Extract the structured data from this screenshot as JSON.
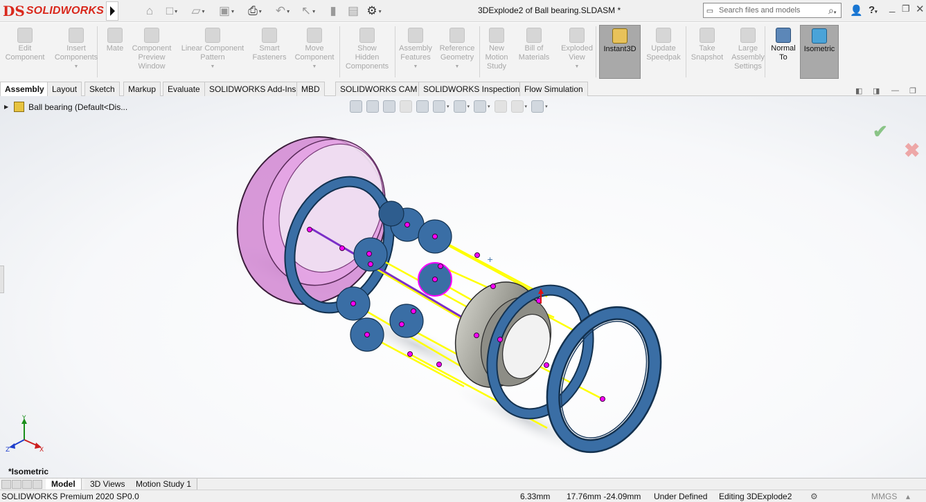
{
  "titlebar": {
    "app_logo": "SOLIDWORKS",
    "logo_mark": "DS",
    "document_title": "3DExplode2 of Ball bearing.SLDASM *",
    "search_placeholder": "Search files and models",
    "quick_access_icons": [
      "home-icon",
      "new-document-icon",
      "open-folder-icon",
      "save-icon",
      "print-icon",
      "undo-icon",
      "select-cursor-icon",
      "rebuild-icon",
      "file-properties-icon",
      "options-gear-icon"
    ],
    "right_icons": [
      "user-icon",
      "help-icon",
      "minimize-icon",
      "restore-icon",
      "close-icon"
    ],
    "help_glyph": "?"
  },
  "commands": [
    {
      "label": "Edit\nComponent",
      "enabled": false
    },
    {
      "label": "Insert\nComponents",
      "enabled": false,
      "dropdown": true
    },
    {
      "label": "Mate",
      "enabled": false
    },
    {
      "label": "Component\nPreview\nWindow",
      "enabled": false
    },
    {
      "label": "Linear Component\nPattern",
      "enabled": false,
      "dropdown": true
    },
    {
      "label": "Smart\nFasteners",
      "enabled": false
    },
    {
      "label": "Move\nComponent",
      "enabled": false,
      "dropdown": true
    },
    {
      "label": "Show\nHidden\nComponents",
      "enabled": false
    },
    {
      "label": "Assembly\nFeatures",
      "enabled": false,
      "dropdown": true
    },
    {
      "label": "Reference\nGeometry",
      "enabled": false,
      "dropdown": true
    },
    {
      "label": "New\nMotion\nStudy",
      "enabled": false
    },
    {
      "label": "Bill of\nMaterials",
      "enabled": false
    },
    {
      "label": "Exploded\nView",
      "enabled": false,
      "dropdown": true
    },
    {
      "label": "Instant3D",
      "enabled": true,
      "pressed": true
    },
    {
      "label": "Update\nSpeedpak",
      "enabled": false
    },
    {
      "label": "Take\nSnapshot",
      "enabled": false
    },
    {
      "label": "Large\nAssembly\nSettings",
      "enabled": false
    },
    {
      "label": "Normal\nTo",
      "enabled": true
    },
    {
      "label": "Isometric",
      "enabled": true,
      "pressed": true
    }
  ],
  "tabs": [
    "Assembly",
    "Layout",
    "Sketch",
    "Markup",
    "Evaluate",
    "SOLIDWORKS Add-Ins",
    "MBD",
    "SOLIDWORKS CAM",
    "SOLIDWORKS Inspection",
    "Flow Simulation"
  ],
  "active_tab": "Assembly",
  "feature_tree": {
    "root_label": "Ball bearing  (Default<Dis..."
  },
  "viewport": {
    "view_name": "*Isometric",
    "triad_labels": {
      "x": "X",
      "y": "Y",
      "z": "Z"
    }
  },
  "bottom_tabs": [
    "Model",
    "3D Views",
    "Motion Study 1"
  ],
  "active_bottom_tab": "Model",
  "status": {
    "product": "SOLIDWORKS Premium 2020 SP0.0",
    "measure": "6.33mm",
    "coords": "17.76mm -24.09mm",
    "definition": "Under Defined",
    "editing": "Editing 3DExplode2",
    "units": "MMGS"
  },
  "colors": {
    "outer_ring": "#cc77cc",
    "components": "#3a6ea5",
    "explode_lines": "#ffff00",
    "handle_points": "#ff00ff",
    "inner_race": "#9a9a92"
  }
}
